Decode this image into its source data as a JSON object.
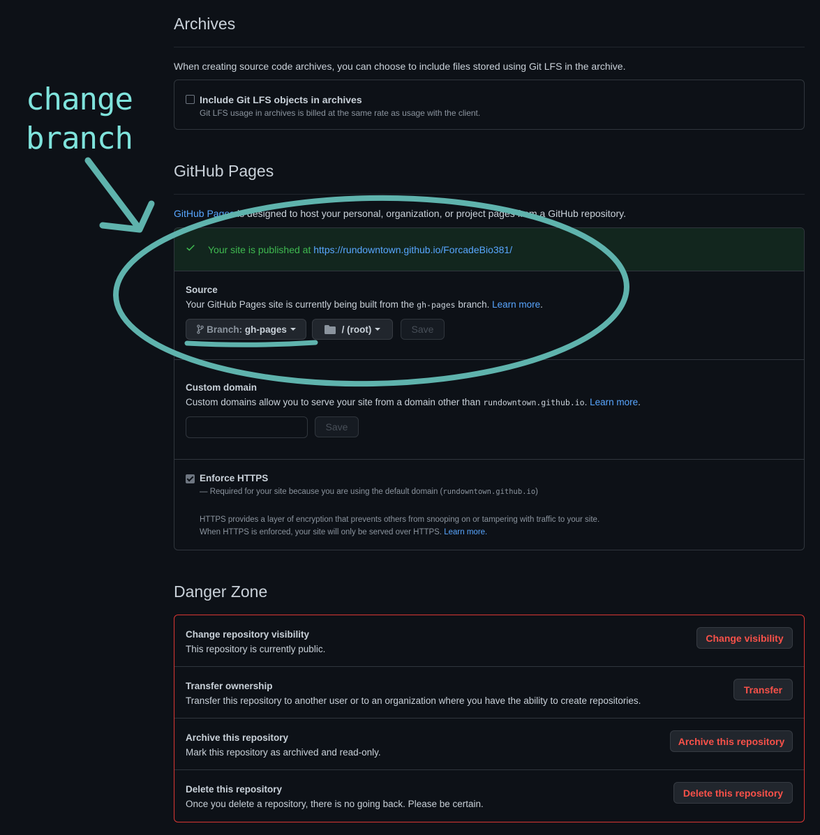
{
  "archives": {
    "heading": "Archives",
    "description": "When creating source code archives, you can choose to include files stored using Git LFS in the archive.",
    "lfs_label": "Include Git LFS objects in archives",
    "lfs_note": "Git LFS usage in archives is billed at the same rate as usage with the client.",
    "lfs_checked": false
  },
  "annotation": {
    "line1": "change",
    "line2": "branch",
    "color": "#5fb3ad",
    "text_color": "#7fe3dc"
  },
  "pages": {
    "heading": "GitHub Pages",
    "intro_link": "GitHub Pages",
    "intro_rest": " is designed to host your personal, organization, or project pages from a GitHub repository.",
    "published_text": "Your site is published at ",
    "published_url": "https://rundowntown.github.io/ForcadeBio381/",
    "source": {
      "title": "Source",
      "desc_before": "Your GitHub Pages site is currently being built from the ",
      "desc_code": "gh-pages",
      "desc_after": " branch. ",
      "learn_more": "Learn more",
      "period": ".",
      "branch_prefix": "Branch: ",
      "branch_value": "gh-pages",
      "folder_value": "/ (root)",
      "save_label": "Save"
    },
    "custom_domain": {
      "title": "Custom domain",
      "desc_before": "Custom domains allow you to serve your site from a domain other than ",
      "desc_code": "rundowntown.github.io",
      "desc_after": ". ",
      "learn_more": "Learn more",
      "period": ".",
      "input_value": "",
      "save_label": "Save"
    },
    "https": {
      "title": "Enforce HTTPS",
      "checked": true,
      "required_before": "— Required for your site because you are using the default domain (",
      "required_code": "rundowntown.github.io",
      "required_after": ")",
      "info_line1": "HTTPS provides a layer of encryption that prevents others from snooping on or tampering with traffic to your site.",
      "info_line2": "When HTTPS is enforced, your site will only be served over HTTPS. ",
      "learn_more": "Learn more."
    }
  },
  "danger": {
    "heading": "Danger Zone",
    "items": [
      {
        "title": "Change repository visibility",
        "desc": "This repository is currently public.",
        "button": "Change visibility"
      },
      {
        "title": "Transfer ownership",
        "desc": "Transfer this repository to another user or to an organization where you have the ability to create repositories.",
        "button": "Transfer"
      },
      {
        "title": "Archive this repository",
        "desc": "Mark this repository as archived and read-only.",
        "button": "Archive this repository"
      },
      {
        "title": "Delete this repository",
        "desc": "Once you delete a repository, there is no going back. Please be certain.",
        "button": "Delete this repository"
      }
    ]
  },
  "colors": {
    "background": "#0d1117",
    "link": "#58a6ff",
    "success": "#3fb950",
    "danger": "#f85149",
    "danger_border": "#da3633"
  }
}
